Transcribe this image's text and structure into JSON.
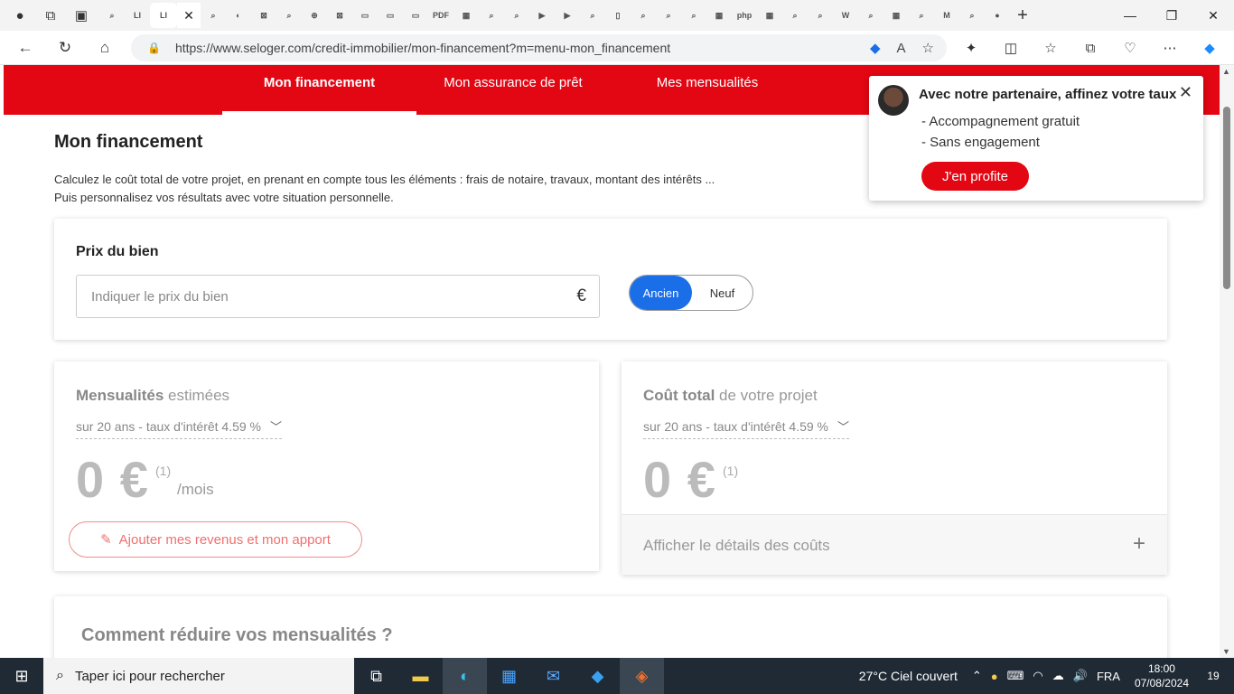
{
  "browser": {
    "url": "https://www.seloger.com/credit-immobilier/mon-financement?m=menu-mon_financement",
    "tab_glyphs": [
      "⌕",
      "LI",
      "LI",
      "⌕",
      "◐",
      "⊠",
      "⌕",
      "⊕",
      "⊠",
      "▭",
      "▭",
      "▭",
      "PDF",
      "▦",
      "⌕",
      "⌕",
      "▶",
      "▶",
      "⌕",
      "▯",
      "⌕",
      "⌕",
      "⌕",
      "▦",
      "php",
      "▦",
      "⌕",
      "⌕",
      "W",
      "⌕",
      "▦",
      "⌕",
      "M",
      "⌕",
      "●"
    ],
    "close_tab": "✕",
    "new_tab": "+"
  },
  "site_nav": {
    "items": [
      {
        "label": "Mon financement"
      },
      {
        "label": "Mon assurance de prêt"
      },
      {
        "label": "Mes mensualités"
      }
    ]
  },
  "main": {
    "title": "Mon financement",
    "desc_line1": "Calculez le coût total de votre projet, en prenant en compte tous les éléments : frais de notaire, travaux, montant des intérêts ...",
    "desc_line2": "Puis personnalisez vos résultats avec votre situation personnelle."
  },
  "price_card": {
    "label": "Prix du bien",
    "placeholder": "Indiquer le prix du bien",
    "currency": "€",
    "toggle_on": "Ancien",
    "toggle_off": "Neuf"
  },
  "monthly_card": {
    "title_bold": "Mensualités",
    "title_rest": " estimées",
    "dropdown": "sur 20 ans - taux d'intérêt 4.59 %",
    "value": "0 €",
    "footnote": "(1)",
    "unit": "/mois",
    "button": "Ajouter mes revenus et mon apport"
  },
  "total_card": {
    "title_bold": "Coût total",
    "title_rest": " de votre projet",
    "dropdown": "sur 20 ans - taux d'intérêt 4.59 %",
    "value": "0 €",
    "footnote": "(1)",
    "details": "Afficher le détails des coûts"
  },
  "reduce_card": {
    "title": "Comment réduire vos mensualités ?"
  },
  "popup": {
    "title": "Avec notre partenaire, affinez votre taux",
    "line1": "- Accompagnement gratuit",
    "line2": "- Sans engagement",
    "button": "J'en profite"
  },
  "taskbar": {
    "search_placeholder": "Taper ici pour rechercher",
    "weather": "27°C  Ciel couvert",
    "lang": "FRA",
    "time": "18:00",
    "date": "07/08/2024",
    "notifications": "19"
  },
  "colors": {
    "brand_red": "#e30613",
    "toggle_blue": "#1a6ee8"
  }
}
